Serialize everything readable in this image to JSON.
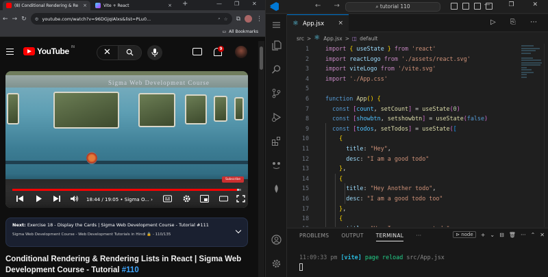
{
  "browser": {
    "tabs": [
      {
        "label": "(8) Conditional Rendering & Re",
        "close": "×"
      },
      {
        "label": "Vite + React",
        "close": "×"
      }
    ],
    "new_tab": "+",
    "window_controls": [
      "—",
      "❐",
      "✕"
    ],
    "nav": {
      "back": "←",
      "forward": "→",
      "reload": "↻"
    },
    "url": "youtube.com/watch?v=96DGjqIAlxs&list=PLu0...",
    "bookmarks_label": "All Bookmarks"
  },
  "youtube": {
    "logo_text": "YouTube",
    "logo_country": "IN",
    "notification_count": "9",
    "search_clear": "✕",
    "player": {
      "train_text": "Sigma Web Development Course",
      "subscribe_chip": "Subscribe",
      "time_current": "18:44",
      "time_total": "19:05",
      "chapter": "Sigma O...",
      "progress": 0.982,
      "buffered": 0.99
    },
    "up_next": {
      "prefix": "Next:",
      "title": "Exercise 18 - Display the Cards | Sigma Web Development Course - Tutorial #111",
      "playlist": "Sigma Web Development Course - Web Development Tutorials in Hindi",
      "position": "110/135"
    },
    "video_title": "Conditional Rendering & Rendering Lists in React | Sigma Web Development Course - Tutorial",
    "video_title_tag": "#110"
  },
  "vscode": {
    "search_label": "tutorial 110",
    "nav_arrows": "← →",
    "window_controls": "— ❐ ✕",
    "tab_label": "App.jsx",
    "tab_close": "×",
    "editor_actions": "▷ ⎘ ⋯",
    "breadcrumb": {
      "folder": "src",
      "sep": ">",
      "file": "App.jsx",
      "symbol": "default"
    },
    "start_line": 1,
    "panel": {
      "tabs": [
        "PROBLEMS",
        "OUTPUT",
        "TERMINAL",
        "···"
      ],
      "active_tab": "TERMINAL",
      "terminal_name": "node",
      "actions": [
        "+",
        "⌄",
        "⊟",
        "🗑",
        "···",
        "⌃",
        "✕"
      ],
      "log_time": "11:09:33 pm",
      "log_tag": "[vite]",
      "log_msg": "page reload",
      "log_file": "src/App.jsx"
    }
  }
}
